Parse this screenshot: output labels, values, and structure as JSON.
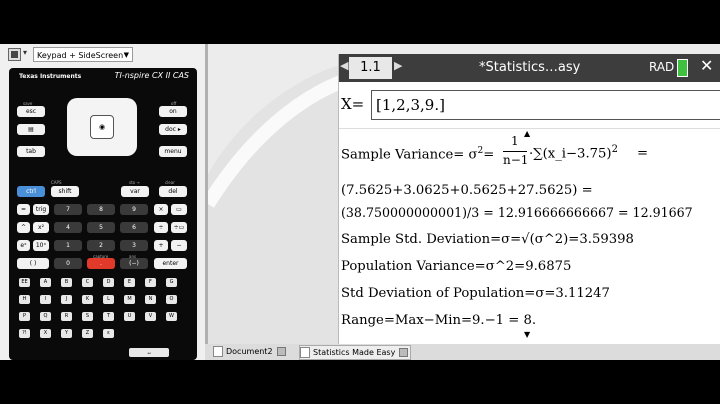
{
  "toolbar": {
    "view_select": "Keypad + SideScreen"
  },
  "calculator": {
    "brand": "Texas Instruments",
    "model": "TI-nspire CX II CAS",
    "keys": {
      "esc": "esc",
      "doc": "doc ▸",
      "tab": "tab",
      "menu": "menu",
      "on": "on",
      "ctrl": "ctrl",
      "shift": "shift",
      "var": "var",
      "del": "del",
      "trig": "trig",
      "n7": "7",
      "n8": "8",
      "n9": "9",
      "n4": "4",
      "n5": "5",
      "n6": "6",
      "ex": "eˣ",
      "tenx": "10ˣ",
      "n1": "1",
      "n2": "2",
      "n3": "3",
      "parens": "( )",
      "n0": "0",
      "neg": "(−)",
      "enter": "enter"
    },
    "key_labels": {
      "save": "save",
      "off": "off",
      "caps": "CAPS",
      "sto": "sto →",
      "clear": "clear",
      "capture": "capture",
      "ans": "ans"
    },
    "alpha_rows": [
      [
        "EE",
        "A",
        "B",
        "C",
        "D",
        "E",
        "F",
        "G"
      ],
      [
        "H",
        "I",
        "J",
        "K",
        "L",
        "M",
        "N",
        "O"
      ],
      [
        "P",
        "Q",
        "R",
        "S",
        "T",
        "U",
        "V",
        "W"
      ],
      [
        "?!",
        "X",
        "Y",
        "Z",
        "ε",
        "",
        "",
        ""
      ]
    ]
  },
  "screen": {
    "page": "1.1",
    "title": "*Statistics…asy",
    "angle_mode": "RAD",
    "x_label": "X=",
    "x_value": "[1,2,3,9.]",
    "lines": {
      "var_label": "Sample Variance= σ",
      "var_exp": "2",
      "var_eq": "=",
      "frac_num": "1",
      "frac_den": "n−1",
      "var_sum": "·∑(x_i−3.75)",
      "var_sum_exp": "2",
      "var_tail": "=",
      "sum_line": "(7.5625+3.0625+0.5625+27.5625) =",
      "result_line": "(38.750000000001)/3 = 12.916666666667 = 12.91667",
      "sd_line": "Sample Std. Deviation=σ=√(σ^2)=3.59398",
      "pop_var": "Population Variance=σ^2=9.6875",
      "pop_sd": "Std Deviation of Population=σ=3.11247",
      "range": "Range=Max−Min=9.−1 = 8."
    }
  },
  "taskbar": {
    "tab1": "Document2",
    "tab2": "Statistics Made Easy"
  },
  "colors": {
    "titlebar": "#3d3d3d",
    "battery": "#3fc03f",
    "ctrl_key": "#4a90d9",
    "capture_key": "#e23a2a"
  }
}
